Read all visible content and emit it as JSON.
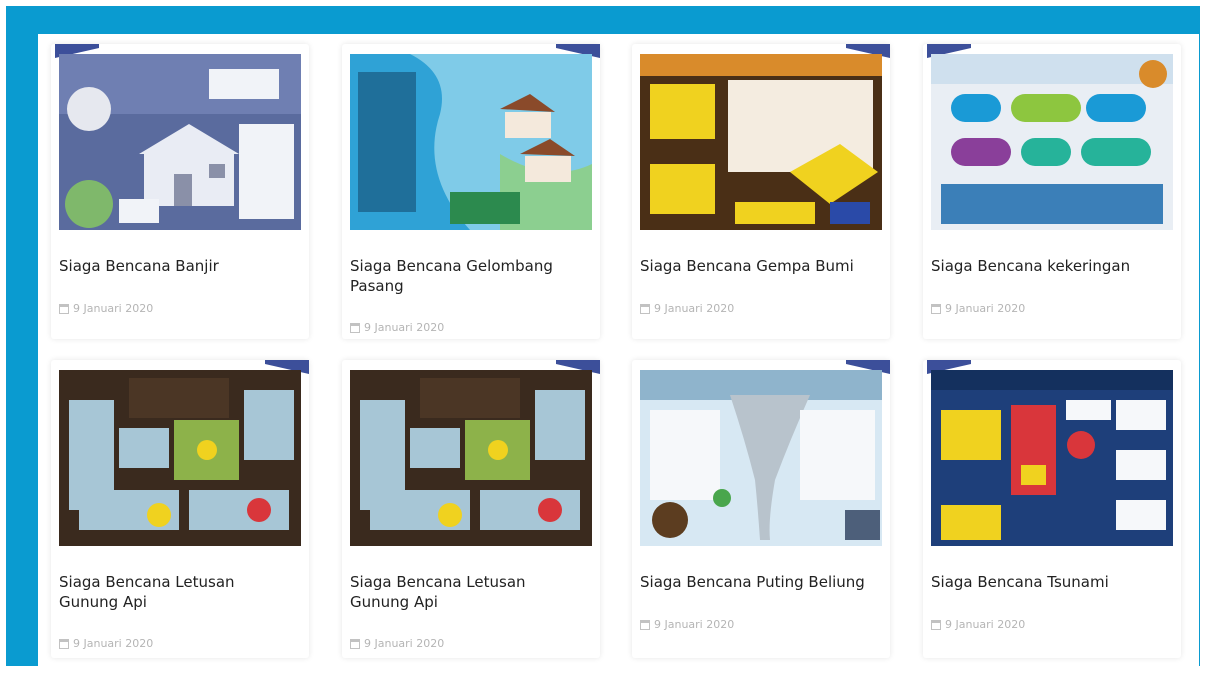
{
  "frame": {
    "border_color": "#0a9bd0"
  },
  "cards": [
    {
      "title": "Siaga Bencana Banjir",
      "date": "9 Januari 2020",
      "theme": "flood",
      "bg": "#5a6b9e"
    },
    {
      "title": "Siaga Bencana Gelombang Pasang",
      "date": "9 Januari 2020",
      "theme": "tide",
      "bg": "#2fa2d6"
    },
    {
      "title": "Siaga Bencana Gempa Bumi",
      "date": "9 Januari 2020",
      "theme": "quake",
      "bg": "#4a2f16"
    },
    {
      "title": "Siaga Bencana kekeringan",
      "date": "9 Januari 2020",
      "theme": "drought",
      "bg": "#e9eef4"
    },
    {
      "title": "Siaga Bencana Letusan Gunung Api",
      "date": "9 Januari 2020",
      "theme": "volcano",
      "bg": "#3a2a1e"
    },
    {
      "title": "Siaga Bencana Letusan Gunung Api",
      "date": "9 Januari 2020",
      "theme": "volcano",
      "bg": "#3a2a1e"
    },
    {
      "title": "Siaga Bencana Puting Beliung",
      "date": "9 Januari 2020",
      "theme": "tornado",
      "bg": "#d7e8f3"
    },
    {
      "title": "Siaga Bencana Tsunami",
      "date": "9 Januari 2020",
      "theme": "tsunami",
      "bg": "#1e3f7a"
    }
  ]
}
